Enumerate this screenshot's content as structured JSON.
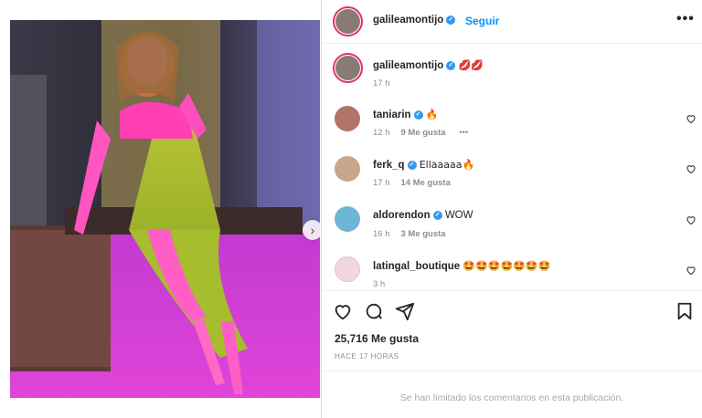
{
  "post": {
    "media_alt": "photo",
    "next_glyph": "›",
    "slide_count": 3,
    "active_slide": 0
  },
  "header": {
    "username": "galileamontijo",
    "verified_glyph": "✓",
    "follow_label": "Seguir",
    "more_glyph": "•••"
  },
  "caption": {
    "username": "galileamontijo",
    "text": "💋💋",
    "time": "17 h"
  },
  "comments": [
    {
      "username": "taniarin",
      "text": "🔥",
      "time": "12 h",
      "likes": "9 Me gusta",
      "more": "•••",
      "avatar_color": "#b0746a"
    },
    {
      "username": "ferk_q",
      "text": "Ellaaaaa🔥",
      "time": "17 h",
      "likes": "14 Me gusta",
      "avatar_color": "#c9a58a"
    },
    {
      "username": "aldorendon",
      "text": "WOW",
      "time": "16 h",
      "likes": "3 Me gusta",
      "avatar_color": "#6fb6d6"
    },
    {
      "username": "latingal_boutique",
      "text": "🤩🤩🤩🤩🤩🤩🤩",
      "time": "3 h",
      "likes": "",
      "avatar_color": "#f2d6de"
    }
  ],
  "footer": {
    "likes": "25,716 Me gusta",
    "posted": "HACE 17 HORAS",
    "limited": "Se han limitado los comentarios en esta publicación."
  },
  "colors": {
    "accent": "#0095f6",
    "verified": "#3897f0",
    "ring": "#e1306c"
  }
}
